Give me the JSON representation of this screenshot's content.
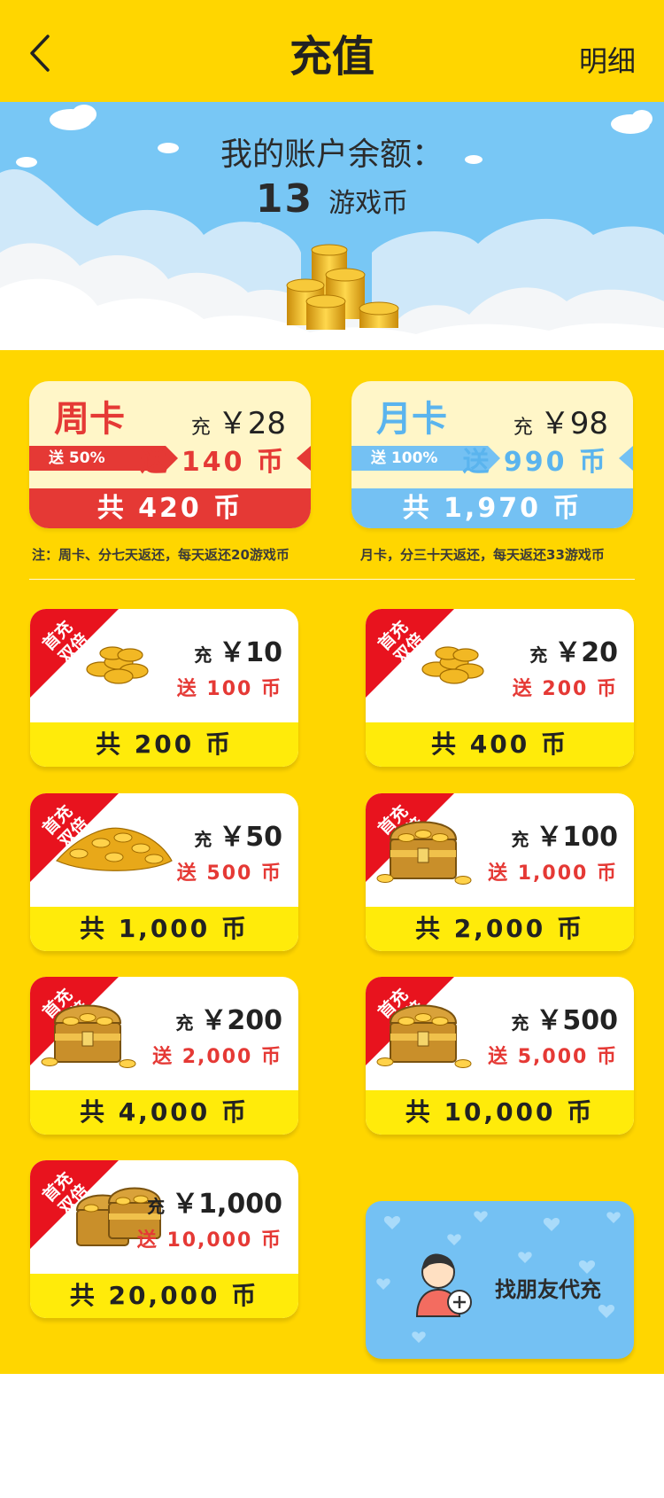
{
  "header": {
    "title": "充值",
    "detail_label": "明细",
    "background": "#FFD600",
    "back_icon": "chevron-left-icon"
  },
  "balance": {
    "label": "我的账户余额：",
    "value": "13",
    "unit": "游戏币"
  },
  "plans": {
    "week": {
      "name": "周卡",
      "charge_prefix": "充",
      "price": "￥28",
      "bonus_ratio": "送 50%",
      "bonus": "送 140 币",
      "total": "共 420 币",
      "note": "注：周卡、分七天返还，每天返还20游戏币",
      "color": "#E53935"
    },
    "month": {
      "name": "月卡",
      "charge_prefix": "充",
      "price": "￥98",
      "bonus_ratio": "送 100%",
      "bonus": "送 990 币",
      "total": "共 1,970 币",
      "note": "月卡，分三十天返还，每天返还33游戏币",
      "color": "#74C1F3"
    }
  },
  "packages": [
    {
      "badge": [
        "首充",
        "双倍"
      ],
      "charge_prefix": "充",
      "price": "￥10",
      "bonus": "送 100 币",
      "total": "共 200 币",
      "art": "coin-pile-small"
    },
    {
      "badge": [
        "首充",
        "双倍"
      ],
      "charge_prefix": "充",
      "price": "￥20",
      "bonus": "送 200 币",
      "total": "共 400 币",
      "art": "coin-pile-small"
    },
    {
      "badge": [
        "首充",
        "双倍"
      ],
      "charge_prefix": "充",
      "price": "￥50",
      "bonus": "送 500 币",
      "total": "共 1,000 币",
      "art": "coin-pile-large"
    },
    {
      "badge": [
        "首充",
        "双倍"
      ],
      "charge_prefix": "充",
      "price": "￥100",
      "bonus": "送 1,000 币",
      "total": "共 2,000 币",
      "art": "treasure-chest"
    },
    {
      "badge": [
        "首充",
        "双倍"
      ],
      "charge_prefix": "充",
      "price": "￥200",
      "bonus": "送 2,000 币",
      "total": "共 4,000 币",
      "art": "treasure-chest"
    },
    {
      "badge": [
        "首充",
        "双倍"
      ],
      "charge_prefix": "充",
      "price": "￥500",
      "bonus": "送 5,000 币",
      "total": "共 10,000 币",
      "art": "treasure-chest"
    },
    {
      "badge": [
        "首充",
        "双倍"
      ],
      "charge_prefix": "充",
      "price": "￥1,000",
      "bonus": "送 10,000 币",
      "total": "共 20,000 币",
      "art": "treasure-chests"
    }
  ],
  "friend_recharge": {
    "label": "找朋友代充",
    "icon": "person-add-icon"
  },
  "colors": {
    "main_yellow": "#FFD600",
    "sky_blue": "#78C7F5",
    "bonus_red": "#E53935",
    "total_bar_yellow": "#FFEB0A"
  }
}
